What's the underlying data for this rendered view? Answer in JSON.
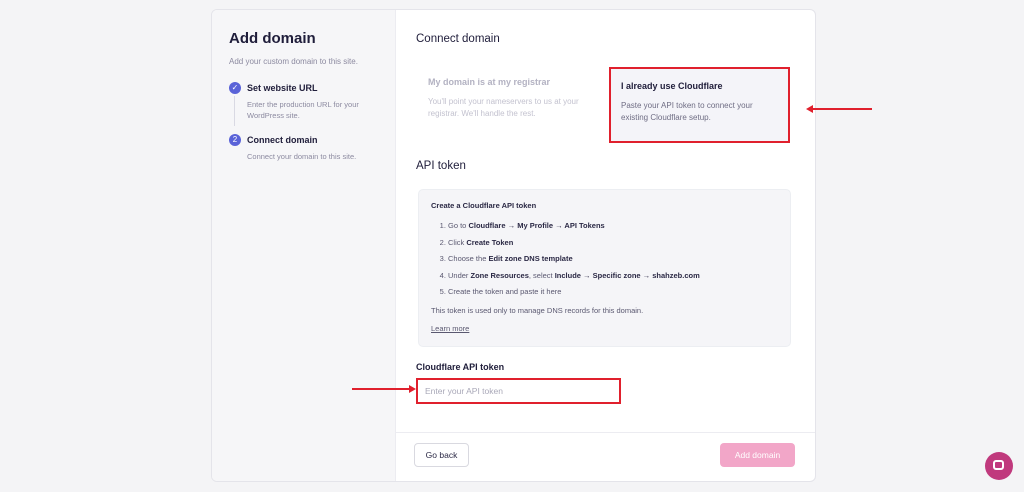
{
  "sidebar": {
    "title": "Add domain",
    "subtitle": "Add your custom domain to this site.",
    "steps": [
      {
        "marker": "✓",
        "title": "Set website URL",
        "desc": "Enter the production URL for your WordPress site."
      },
      {
        "marker": "2",
        "title": "Connect domain",
        "desc": "Connect your domain to this site."
      }
    ]
  },
  "main": {
    "heading": "Connect domain",
    "options": [
      {
        "title": "My domain is at my registrar",
        "desc": "You'll point your nameservers to us at your registrar. We'll handle the rest.",
        "selected": false
      },
      {
        "title": "I already use Cloudflare",
        "desc": "Paste your API token to connect your existing Cloudflare setup.",
        "selected": true
      }
    ],
    "api_heading": "API token",
    "info": {
      "title": "Create a Cloudflare API token",
      "step1": {
        "a": "Go to ",
        "b": "Cloudflare → My Profile → API Tokens"
      },
      "step2": {
        "a": "Click ",
        "b": "Create Token"
      },
      "step3": {
        "a": "Choose the ",
        "b": "Edit zone DNS template"
      },
      "step4": {
        "a": "Under ",
        "b": "Zone Resources",
        "c": ", select ",
        "d": "Include → Specific zone → shahzeb.com"
      },
      "step5": "Create the token and paste it here",
      "note": "This token is used only to manage DNS records for this domain.",
      "learn_more": "Learn more"
    },
    "field": {
      "label": "Cloudflare API token",
      "placeholder": "Enter your API token",
      "value": ""
    }
  },
  "footer": {
    "back_label": "Go back",
    "add_label": "Add domain"
  },
  "colors": {
    "accent": "#5a63d8",
    "highlight": "#e0202d",
    "primary_disabled": "#f2a6c8",
    "chat": "#c0397d"
  }
}
